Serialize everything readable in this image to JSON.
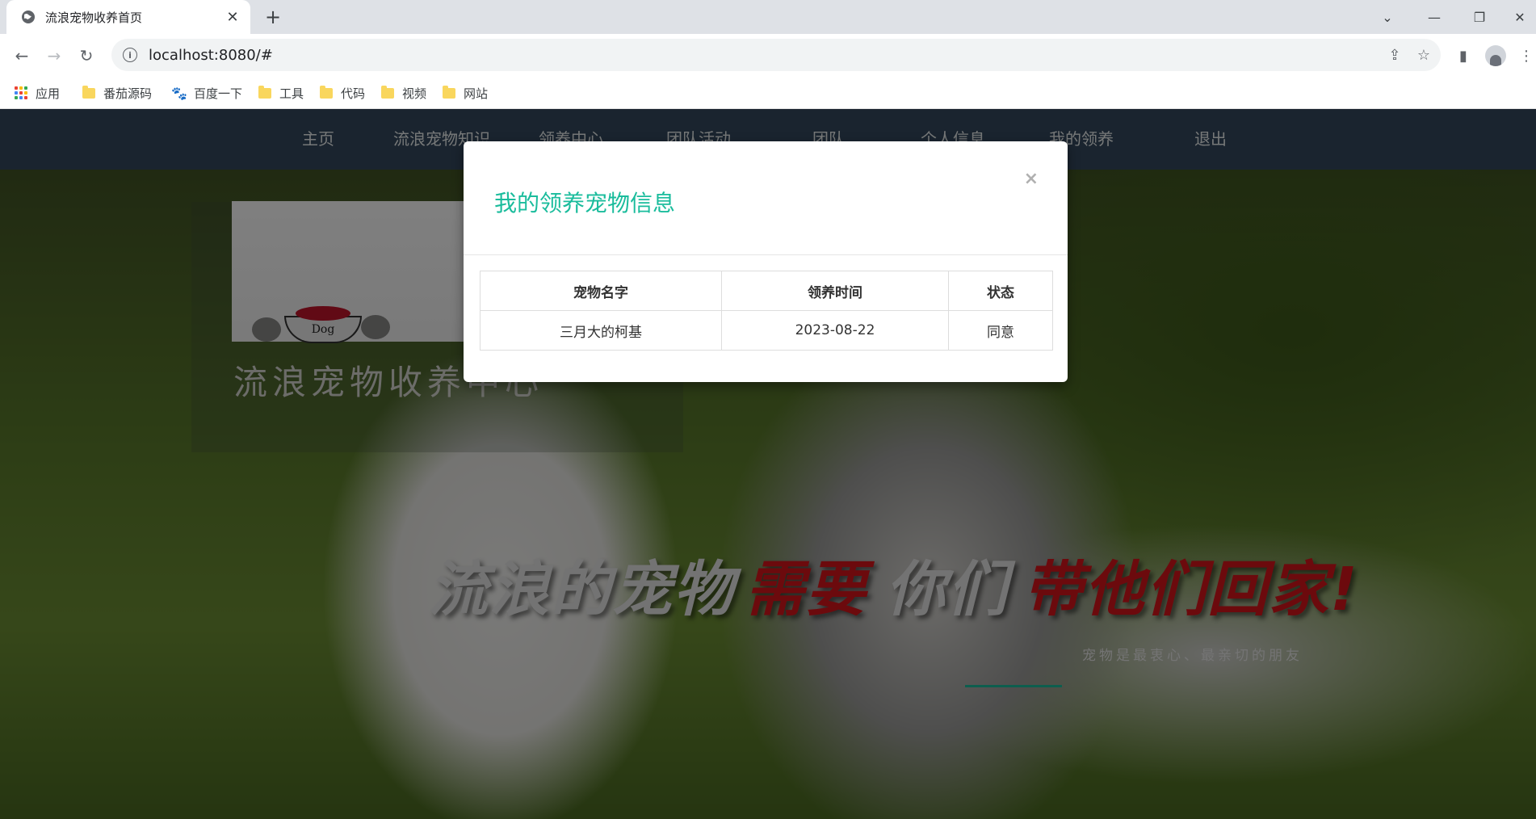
{
  "browser": {
    "tab_title": "流浪宠物收养首页",
    "url": "localhost:8080/#",
    "bookmarks": [
      {
        "label": "应用",
        "icon": "apps-icon"
      },
      {
        "label": "番茄源码",
        "icon": "folder-icon"
      },
      {
        "label": "百度一下",
        "icon": "baidu-paw-icon"
      },
      {
        "label": "工具",
        "icon": "folder-icon"
      },
      {
        "label": "代码",
        "icon": "folder-icon"
      },
      {
        "label": "视频",
        "icon": "folder-icon"
      },
      {
        "label": "网站",
        "icon": "folder-icon"
      }
    ]
  },
  "nav": {
    "items": [
      "主页",
      "流浪宠物知识",
      "领养中心",
      "团队活动",
      "团队",
      "个人信息",
      "我的领养",
      "退出"
    ]
  },
  "hero": {
    "logo_text": "流浪宠物收养中心",
    "bowl_label": "Dog",
    "slogan": {
      "part1": "流浪的宠物",
      "part2": "需要",
      "part3": "你们",
      "part4": "带他们回家!"
    },
    "subline": "宠物是最衷心、最亲切的朋友"
  },
  "modal": {
    "title": "我的领养宠物信息",
    "close": "×",
    "table": {
      "headers": [
        "宠物名字",
        "领养时间",
        "状态"
      ],
      "rows": [
        [
          "三月大的柯基",
          "2023-08-22",
          "同意"
        ]
      ]
    }
  },
  "colors": {
    "nav_bg": "#34495e",
    "accent_teal": "#1abc9c",
    "slogan_red": "#d9151b"
  }
}
